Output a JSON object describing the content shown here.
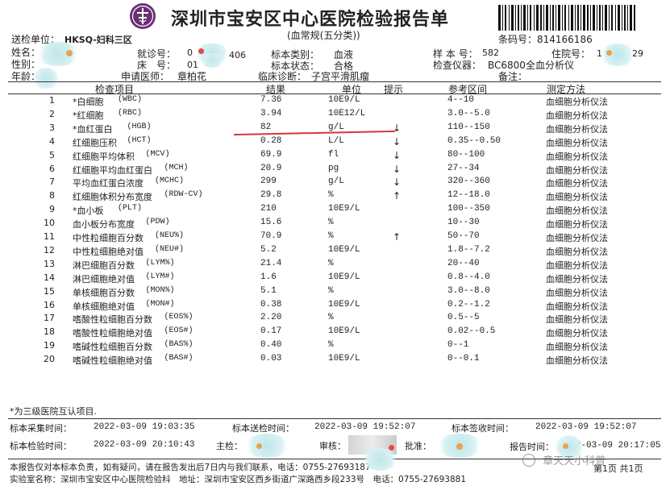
{
  "header": {
    "title": "深圳市宝安区中心医院检验报告单",
    "subtitle": "(血常规(五分类))",
    "barcode_label": "条码号：814166186",
    "send_unit_label": "送检单位：",
    "send_unit_value": "HKSQ-妇科三区"
  },
  "patient": {
    "name_label": "姓名：",
    "sex_label": "性别：",
    "age_label": "年龄：",
    "visit_label": "就诊号：",
    "visit_value": "0",
    "visit_value_suffix": "406",
    "bed_label": "床　号：",
    "bed_value": "01",
    "doctor_label": "申请医师：",
    "doctor_value": "章柏花",
    "specimen_type_label": "标本类别：",
    "specimen_type_value": "血液",
    "specimen_state_label": "标本状态：",
    "specimen_state_value": "合格",
    "diagnosis_label": "临床诊断：",
    "diagnosis_value": "子宫平滑肌瘤",
    "sample_no_label": "样 本 号：",
    "sample_no_value": "582",
    "inpatient_no_label": "住院号：",
    "inpatient_no_value_a": "1",
    "inpatient_no_value_b": "29",
    "instrument_label": "检查仪器：",
    "instrument_value": "BC6800全血分析仪",
    "remark_label": "备注："
  },
  "table": {
    "headers": {
      "item": "检查项目",
      "result": "结果",
      "unit": "单位",
      "flag": "提示",
      "ref": "参考区间",
      "method": "测定方法"
    },
    "rows": [
      {
        "no": "1",
        "name": "*白细胞",
        "abbr": "(WBC)",
        "result": "7.36",
        "unit": "10E9/L",
        "flag": "",
        "ref": "4--10",
        "method": "血细胞分析仪法"
      },
      {
        "no": "2",
        "name": "*红细胞",
        "abbr": "(RBC)",
        "result": "3.94",
        "unit": "10E12/L",
        "flag": "",
        "ref": "3.0--5.0",
        "method": "血细胞分析仪法"
      },
      {
        "no": "3",
        "name": "*血红蛋白",
        "abbr": "(HGB)",
        "result": "82",
        "unit": "g/L",
        "flag": "↓",
        "ref": "110--150",
        "method": "血细胞分析仪法"
      },
      {
        "no": "4",
        "name": "红细胞压积",
        "abbr": "(HCT)",
        "result": "0.28",
        "unit": "L/L",
        "flag": "↓",
        "ref": "0.35--0.50",
        "method": "血细胞分析仪法"
      },
      {
        "no": "5",
        "name": "红细胞平均体积",
        "abbr": "(MCV)",
        "result": "69.9",
        "unit": "fl",
        "flag": "↓",
        "ref": "80--100",
        "method": "血细胞分析仪法"
      },
      {
        "no": "6",
        "name": "红细胞平均血红蛋白",
        "abbr": "(MCH)",
        "result": "20.9",
        "unit": "pg",
        "flag": "↓",
        "ref": "27--34",
        "method": "血细胞分析仪法"
      },
      {
        "no": "7",
        "name": "平均血红蛋白浓度",
        "abbr": "(MCHC)",
        "result": "299",
        "unit": "g/L",
        "flag": "↓",
        "ref": "320--360",
        "method": "血细胞分析仪法"
      },
      {
        "no": "8",
        "name": "红细胞体积分布宽度",
        "abbr": "(RDW-CV)",
        "result": "29.8",
        "unit": "%",
        "flag": "↑",
        "ref": "12--18.0",
        "method": "血细胞分析仪法"
      },
      {
        "no": "9",
        "name": "*血小板",
        "abbr": "(PLT)",
        "result": "210",
        "unit": "10E9/L",
        "flag": "",
        "ref": "100--350",
        "method": "血细胞分析仪法"
      },
      {
        "no": "10",
        "name": "血小板分布宽度",
        "abbr": "(PDW)",
        "result": "15.6",
        "unit": "%",
        "flag": "",
        "ref": "10--30",
        "method": "血细胞分析仪法"
      },
      {
        "no": "11",
        "name": "中性粒细胞百分数",
        "abbr": "(NEU%)",
        "result": "70.9",
        "unit": "%",
        "flag": "↑",
        "ref": "50--70",
        "method": "血细胞分析仪法"
      },
      {
        "no": "12",
        "name": "中性粒细胞绝对值",
        "abbr": "(NEU#)",
        "result": "5.2",
        "unit": "10E9/L",
        "flag": "",
        "ref": "1.8--7.2",
        "method": "血细胞分析仪法"
      },
      {
        "no": "13",
        "name": "淋巴细胞百分数",
        "abbr": "(LYM%)",
        "result": "21.4",
        "unit": "%",
        "flag": "",
        "ref": "20--40",
        "method": "血细胞分析仪法"
      },
      {
        "no": "14",
        "name": "淋巴细胞绝对值",
        "abbr": "(LYM#)",
        "result": "1.6",
        "unit": "10E9/L",
        "flag": "",
        "ref": "0.8--4.0",
        "method": "血细胞分析仪法"
      },
      {
        "no": "15",
        "name": "单核细胞百分数",
        "abbr": "(MON%)",
        "result": "5.1",
        "unit": "%",
        "flag": "",
        "ref": "3.0--8.0",
        "method": "血细胞分析仪法"
      },
      {
        "no": "16",
        "name": "单核细胞绝对值",
        "abbr": "(MON#)",
        "result": "0.38",
        "unit": "10E9/L",
        "flag": "",
        "ref": "0.2--1.2",
        "method": "血细胞分析仪法"
      },
      {
        "no": "17",
        "name": "嗜酸性粒细胞百分数",
        "abbr": "(EOS%)",
        "result": "2.20",
        "unit": "%",
        "flag": "",
        "ref": "0.5--5",
        "method": "血细胞分析仪法"
      },
      {
        "no": "18",
        "name": "嗜酸性粒细胞绝对值",
        "abbr": "(EOS#)",
        "result": "0.17",
        "unit": "10E9/L",
        "flag": "",
        "ref": "0.02--0.5",
        "method": "血细胞分析仪法"
      },
      {
        "no": "19",
        "name": "嗜碱性粒细胞百分数",
        "abbr": "(BAS%)",
        "result": "0.40",
        "unit": "%",
        "flag": "",
        "ref": "0--1",
        "method": "血细胞分析仪法"
      },
      {
        "no": "20",
        "name": "嗜碱性粒细胞绝对值",
        "abbr": "(BAS#)",
        "result": "0.03",
        "unit": "10E9/L",
        "flag": "",
        "ref": "0--0.1",
        "method": "血细胞分析仪法"
      }
    ]
  },
  "footer": {
    "note": "*为三级医院互认项目.",
    "collect_label": "标本采集时间：",
    "collect_time": "2022-03-09 19:03:35",
    "send_label": "标本送检时间：",
    "send_time": "2022-03-09 19:52:07",
    "receive_label": "标本签收时间：",
    "receive_time": "2022-03-09 19:52:07",
    "test_label": "标本检验时间：",
    "test_time": "2022-03-09 20:10:43",
    "chief_label": "主检：",
    "review_label": "审核：",
    "approve_label": "批准：",
    "report_label": "报告时间：",
    "report_time": "2022-03-09 20:17:05",
    "disclaimer": "本报告仅对本标本负责，如有疑问，请在报告发出后7日内与我们联系，电话：0755-27693187",
    "address": "实验室名称：深圳市宝安区中心医院检验科　地址：深圳市宝安区西乡街道广深路西乡段233号　电话：0755-27693881",
    "page": "第1页 共1页",
    "watermark": "章天天小科普"
  },
  "colors": {
    "redline": "#d9343b",
    "logo_purple": "#6b2f75",
    "blur": "#bfe6ea"
  }
}
